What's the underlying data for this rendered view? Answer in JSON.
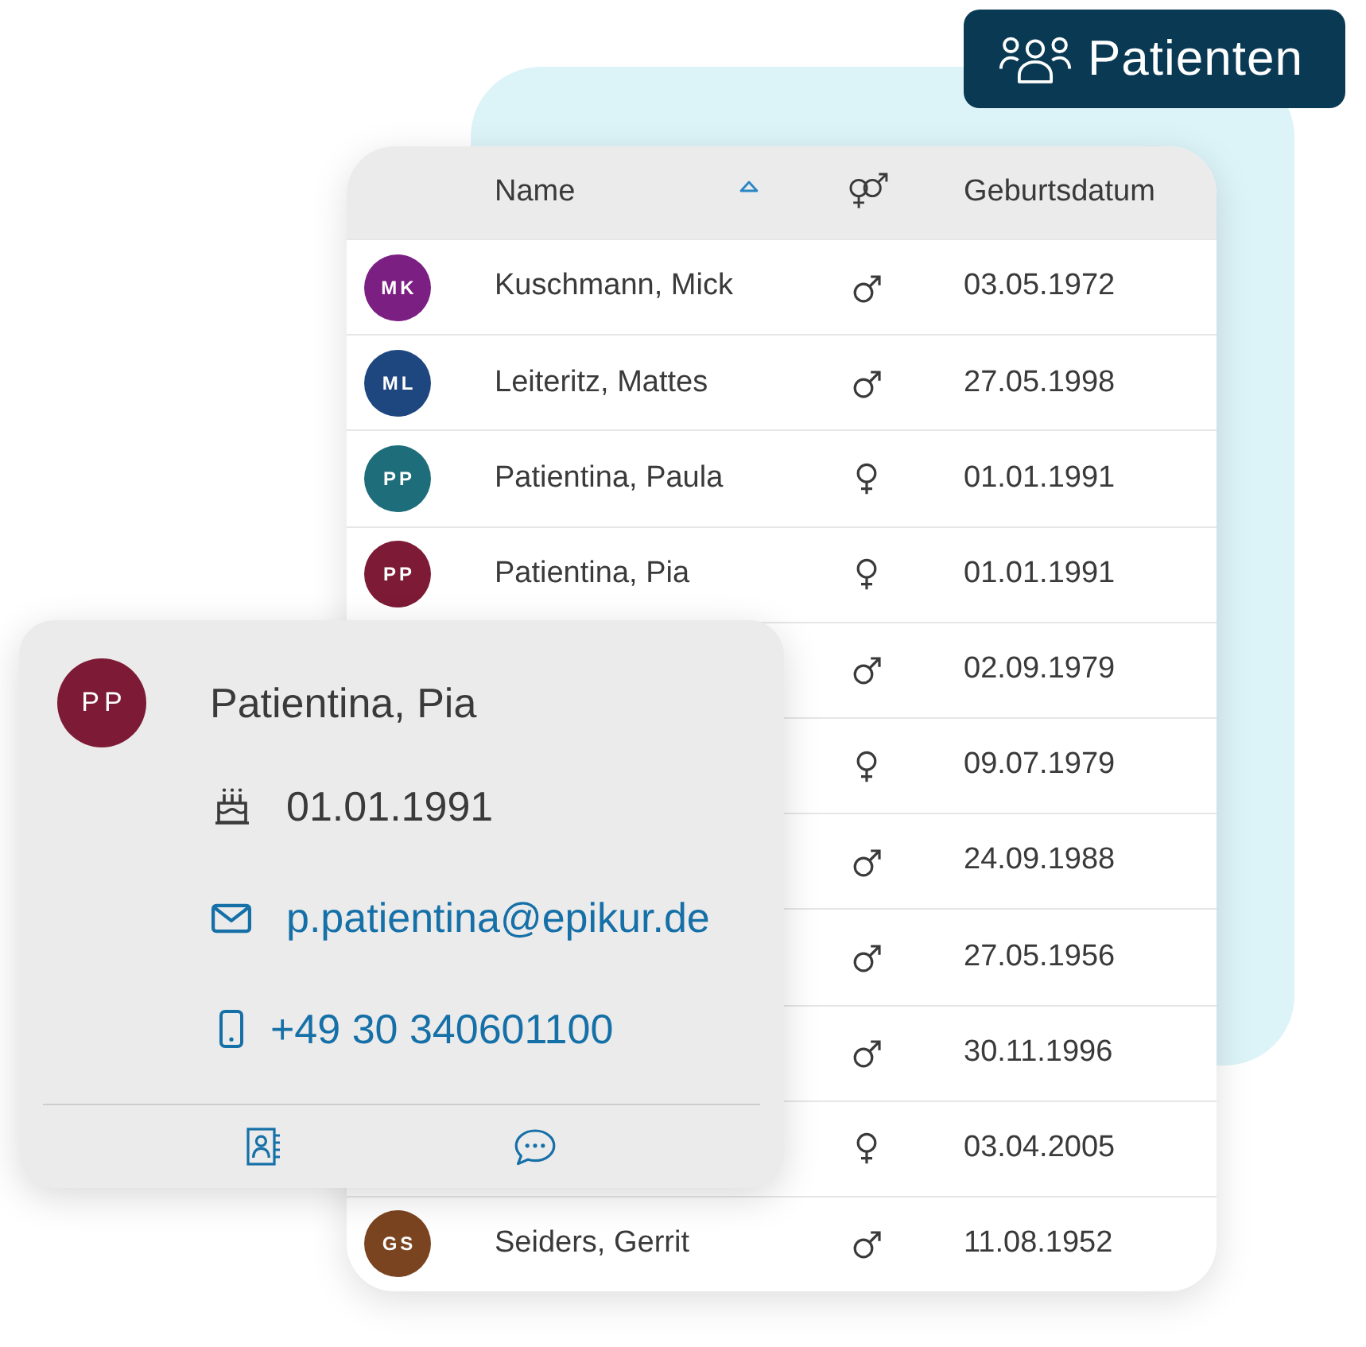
{
  "badge": {
    "label": "Patienten"
  },
  "table": {
    "columns": [
      {
        "kind": "text",
        "label": "Name",
        "sorted_ascending": true
      },
      {
        "kind": "gender"
      },
      {
        "kind": "text",
        "label": "Geburtsdatum"
      }
    ],
    "rows": [
      {
        "initials": "MK",
        "color": "#7b1f82",
        "name": "Kuschmann, Mick",
        "kind": "male",
        "birth_date": "03.05.1972"
      },
      {
        "initials": "ML",
        "color": "#1f477f",
        "name": "Leiteritz, Mattes",
        "kind": "male",
        "birth_date": "27.05.1998"
      },
      {
        "initials": "PP",
        "color": "#1e6d7b",
        "name": "Patientina, Paula",
        "kind": "female",
        "birth_date": "01.01.1991"
      },
      {
        "initials": "PP",
        "color": "#7d1a35",
        "name": "Patientina, Pia",
        "kind": "female",
        "birth_date": "01.01.1991"
      },
      {
        "kind": "male",
        "birth_date": "02.09.1979"
      },
      {
        "kind": "female",
        "birth_date": "09.07.1979"
      },
      {
        "kind": "male",
        "birth_date": "24.09.1988"
      },
      {
        "kind": "male",
        "birth_date": "27.05.1956"
      },
      {
        "kind": "male",
        "birth_date": "30.11.1996"
      },
      {
        "kind": "female",
        "birth_date": "03.04.2005"
      },
      {
        "initials": "GS",
        "color": "#7b4420",
        "name": "Seiders, Gerrit",
        "kind": "male",
        "birth_date": "11.08.1952"
      }
    ]
  },
  "contact_card": {
    "initials": "PP",
    "color": "#7d1a35",
    "name": "Patientina, Pia",
    "details": [
      {
        "kind": "birthday",
        "text": "01.01.1991"
      },
      {
        "kind": "email",
        "text": "p.patientina@epikur.de"
      },
      {
        "kind": "phone",
        "text": "+49 30 340601100"
      }
    ],
    "actions": [
      {
        "kind": "contact"
      },
      {
        "kind": "message"
      }
    ]
  }
}
